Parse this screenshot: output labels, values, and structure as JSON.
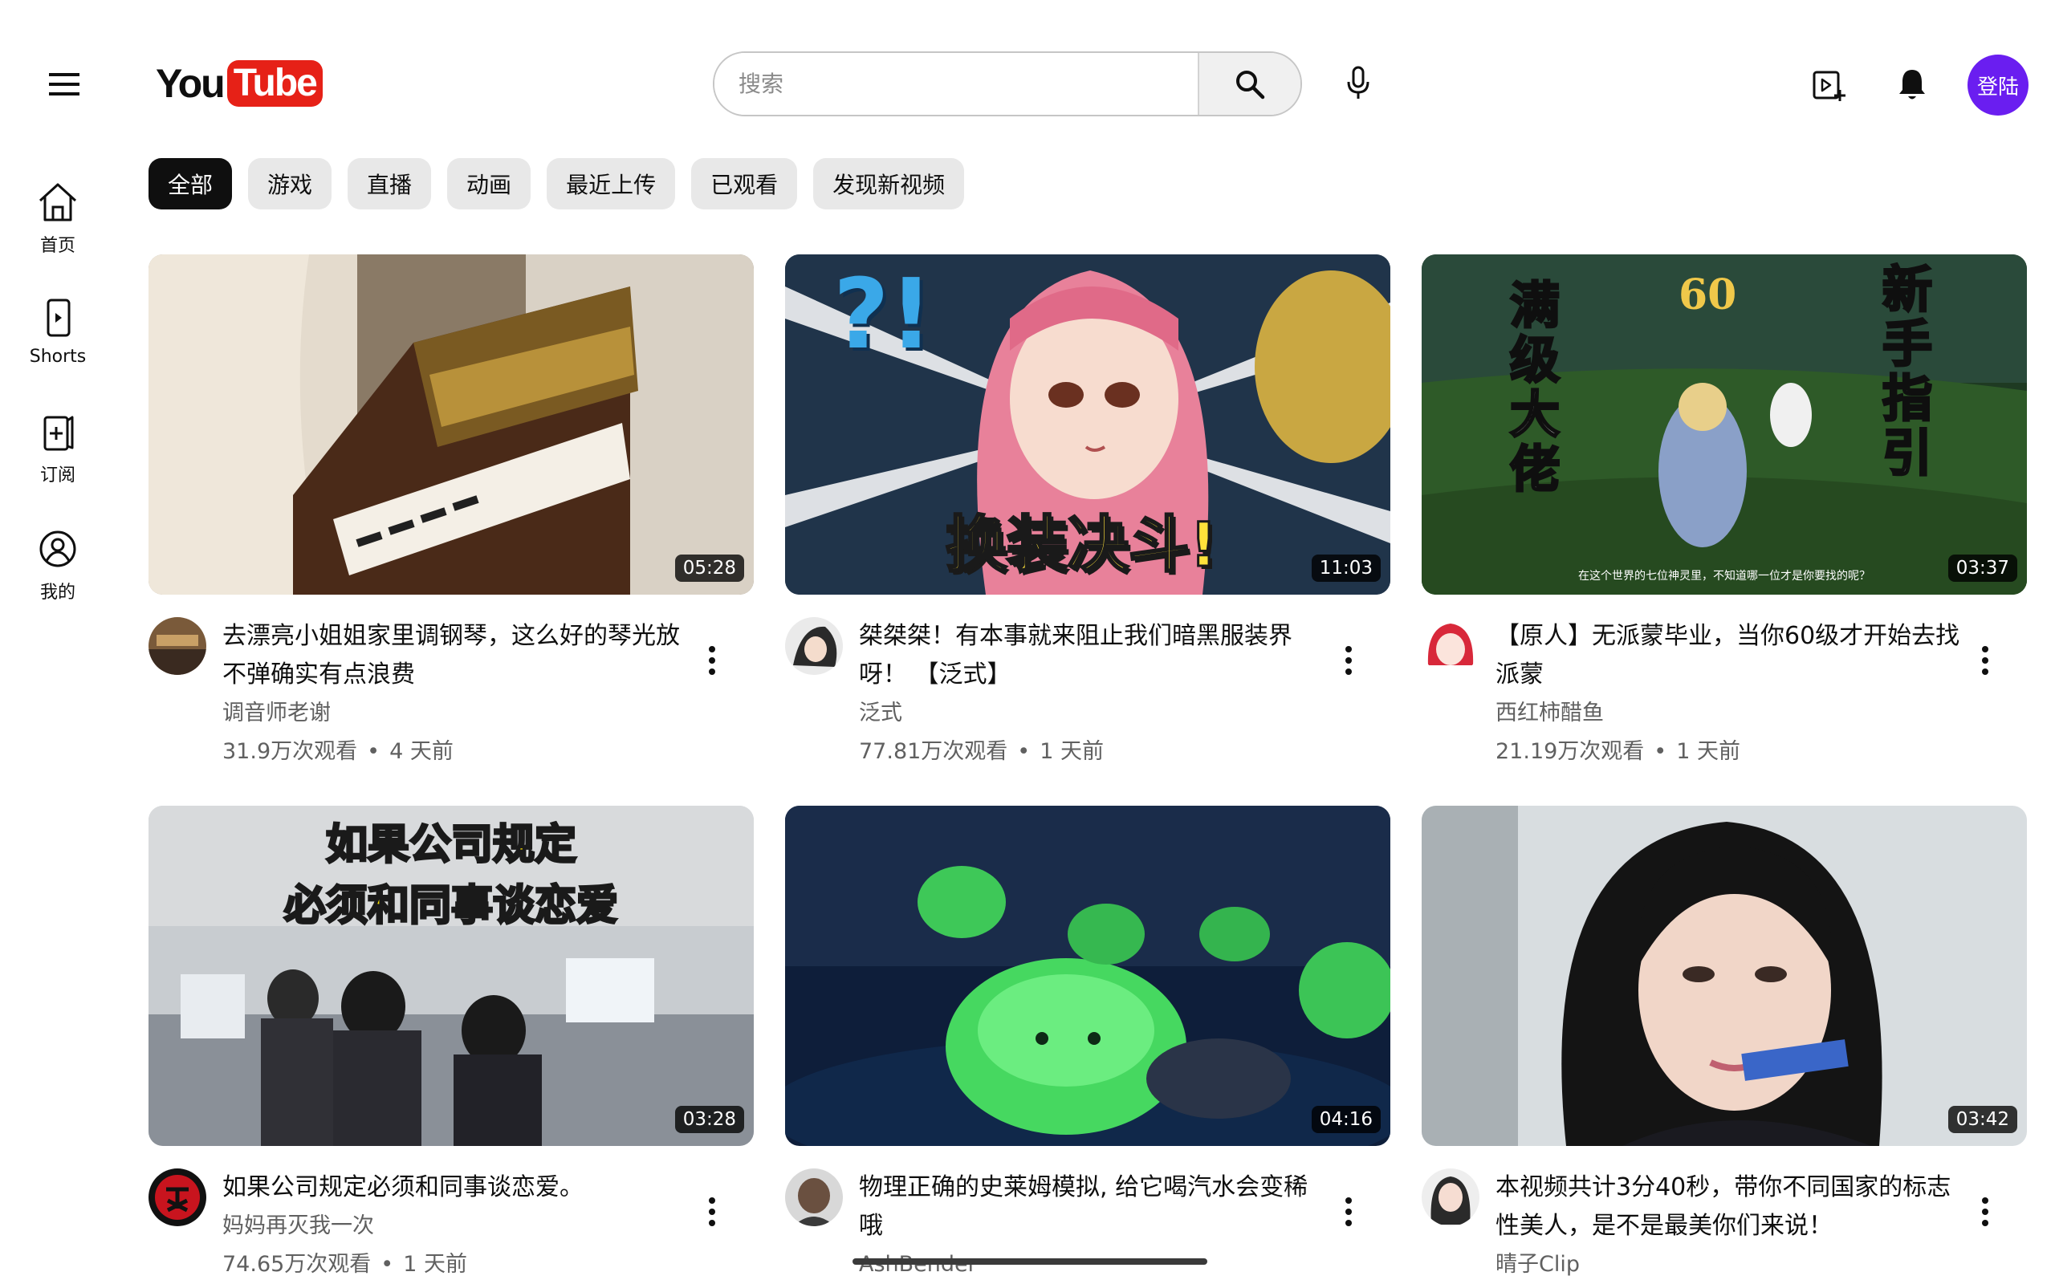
{
  "header": {
    "logo_you": "You",
    "logo_tube": "Tube",
    "search_placeholder": "搜索",
    "login_label": "登陆"
  },
  "sidebar": {
    "items": [
      {
        "label": "首页",
        "icon": "home-icon"
      },
      {
        "label": "Shorts",
        "icon": "shorts-icon"
      },
      {
        "label": "订阅",
        "icon": "subscriptions-icon"
      },
      {
        "label": "我的",
        "icon": "account-icon"
      }
    ]
  },
  "chips": [
    {
      "label": "全部",
      "active": true
    },
    {
      "label": "游戏"
    },
    {
      "label": "直播"
    },
    {
      "label": "动画"
    },
    {
      "label": "最近上传"
    },
    {
      "label": "已观看"
    },
    {
      "label": "发现新视频"
    }
  ],
  "videos": [
    {
      "title": "去漂亮小姐姐家里调钢琴，这么好的琴光放不弹确实有点浪费",
      "channel": "调音师老谢",
      "views": "31.9万次观看",
      "age": "4 天前",
      "duration": "05:28"
    },
    {
      "title": "桀桀桀！有本事就来阻止我们暗黑服装界呀！ 【泛式】",
      "channel": "泛式",
      "views": "77.81万次观看",
      "age": "1 天前",
      "duration": "11:03"
    },
    {
      "title": "【原人】无派蒙毕业，当你60级才开始去找派蒙",
      "channel": "西红柿醋鱼",
      "views": "21.19万次观看",
      "age": "1 天前",
      "duration": "03:37"
    },
    {
      "title": "如果公司规定必须和同事谈恋爱。",
      "channel": "妈妈再灭我一次",
      "views": "74.65万次观看",
      "age": "1 天前",
      "duration": "03:28"
    },
    {
      "title": "物理正确的史莱姆模拟, 给它喝汽水会变稀哦",
      "channel": "AshBender",
      "views": "",
      "age": "",
      "duration": "04:16"
    },
    {
      "title": "本视频共计3分40秒，带你不同国家的标志性美人，是不是最美你们来说！",
      "channel": "晴子Clip",
      "views": "",
      "age": "",
      "duration": "03:42"
    }
  ],
  "thumb_text": {
    "v2_marks": "?!",
    "v2_overlay": "换装决斗!",
    "v3_level": "60",
    "v3_left": "满级大佬",
    "v3_right": "新手指引",
    "v3_caption": "在这个世界的七位神灵里，不知道哪一位才是你要找的呢？",
    "v4_line1": "如果公司规定",
    "v4_line2": "必须和同事谈恋爱"
  },
  "colors": {
    "brand_red": "#e62117",
    "login_purple": "#6a1ef0",
    "chip_active": "#0f0f0f",
    "chip_bg": "#e8e8e8",
    "meta_gray": "#606060"
  }
}
